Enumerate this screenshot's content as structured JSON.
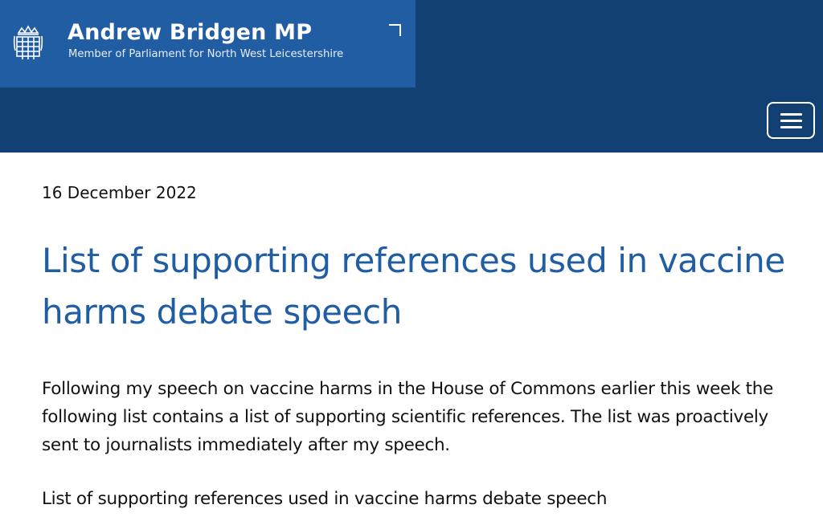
{
  "header": {
    "title": "Andrew Bridgen MP",
    "subtitle": "Member of Parliament for North West Leicestershire",
    "logo_icon": "portcullis-icon",
    "menu_icon": "hamburger-menu-icon",
    "colors": {
      "header_bg": "#134072",
      "brand_bg": "#215da3",
      "title_text": "#ffffff"
    }
  },
  "article": {
    "date": "16 December 2022",
    "title": "List of supporting references used in vaccine harms debate speech",
    "paragraphs": [
      "Following my speech on vaccine harms in the House of Commons earlier this week the following list contains a list of supporting scientific references. The list was proactively sent to journalists immediately after my speech.",
      "List of supporting references used in vaccine harms debate speech"
    ],
    "colors": {
      "title": "#215da3",
      "body": "#111111"
    }
  }
}
